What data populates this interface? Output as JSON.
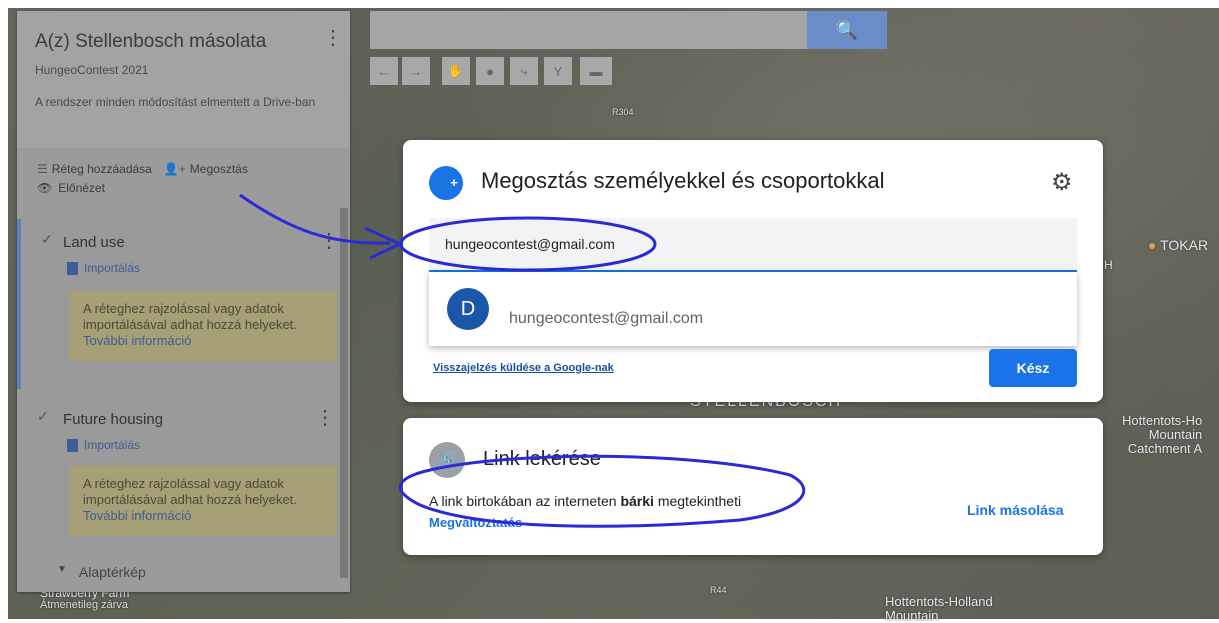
{
  "map_panel": {
    "title": "A(z) Stellenbosch másolata",
    "subtitle": "HungeoContest 2021",
    "save_note": "A rendszer minden módosítást elmentett a Drive-ban",
    "add_layer_label": "Réteg hozzáadása",
    "share_label": "Megosztás",
    "preview_label": "Előnézet",
    "layers": [
      {
        "title": "Land use",
        "import_label": "Importálás",
        "hint": "A réteghez rajzolással vagy adatok importálásával adhat hozzá helyeket.",
        "more": "További információ"
      },
      {
        "title": "Future housing",
        "import_label": "Importálás",
        "hint": "A réteghez rajzolással vagy adatok importálásával adhat hozzá helyeket.",
        "more": "További információ"
      }
    ],
    "basemap_label": "Alaptérkép"
  },
  "map_labels": {
    "stellenbosch": "STELLENBOSCH",
    "tokara": "TOKAR",
    "hottentots_right": "Hottentots-Ho\nMountain\nCatchment A",
    "hottentots_bottom": "Hottentots-Holland\nMountain",
    "strawberry": "Strawberry Farm",
    "temp_closed": "Átmenetileg zárva",
    "road_r304": "R304",
    "road_r44": "R44",
    "letter_h": "H"
  },
  "share_dialog": {
    "title": "Megosztás személyekkel és csoportokkal",
    "email_value": "hungeocontest@gmail.com",
    "suggestion": {
      "avatar_letter": "D",
      "email": "hungeocontest@gmail.com"
    },
    "feedback_link": "Visszajelzés küldése a Google-nak",
    "done_label": "Kész"
  },
  "link_card": {
    "title": "Link lekérése",
    "desc_before": "A link birtokában az interneten ",
    "desc_bold": "bárki",
    "desc_after": " megtekintheti",
    "change_label": "Megváltoztatás",
    "copy_label": "Link másolása"
  },
  "colors": {
    "accent": "#1a73e8",
    "annotation": "#2a2ad6"
  }
}
